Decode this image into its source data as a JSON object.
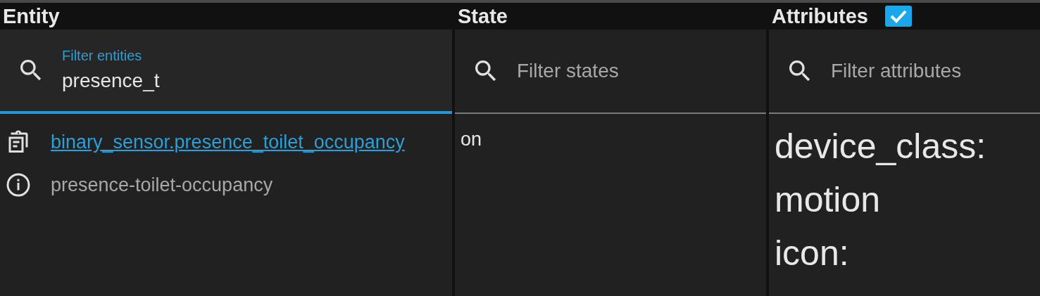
{
  "columns": [
    {
      "label": "Entity"
    },
    {
      "label": "State"
    },
    {
      "label": "Attributes",
      "checked": true
    }
  ],
  "filters": [
    {
      "label": "Filter entities",
      "value": "presence_t",
      "focused": true
    },
    {
      "placeholder": "Filter states",
      "focused": false
    },
    {
      "placeholder": "Filter attributes",
      "focused": false
    }
  ],
  "rows": [
    {
      "entity_id": "binary_sensor.presence_toilet_occupancy",
      "name": "presence-toilet-occupancy",
      "state": "on",
      "attributes": [
        {
          "key": "device_class:",
          "value": "motion"
        },
        {
          "key": "icon:"
        }
      ]
    }
  ]
}
